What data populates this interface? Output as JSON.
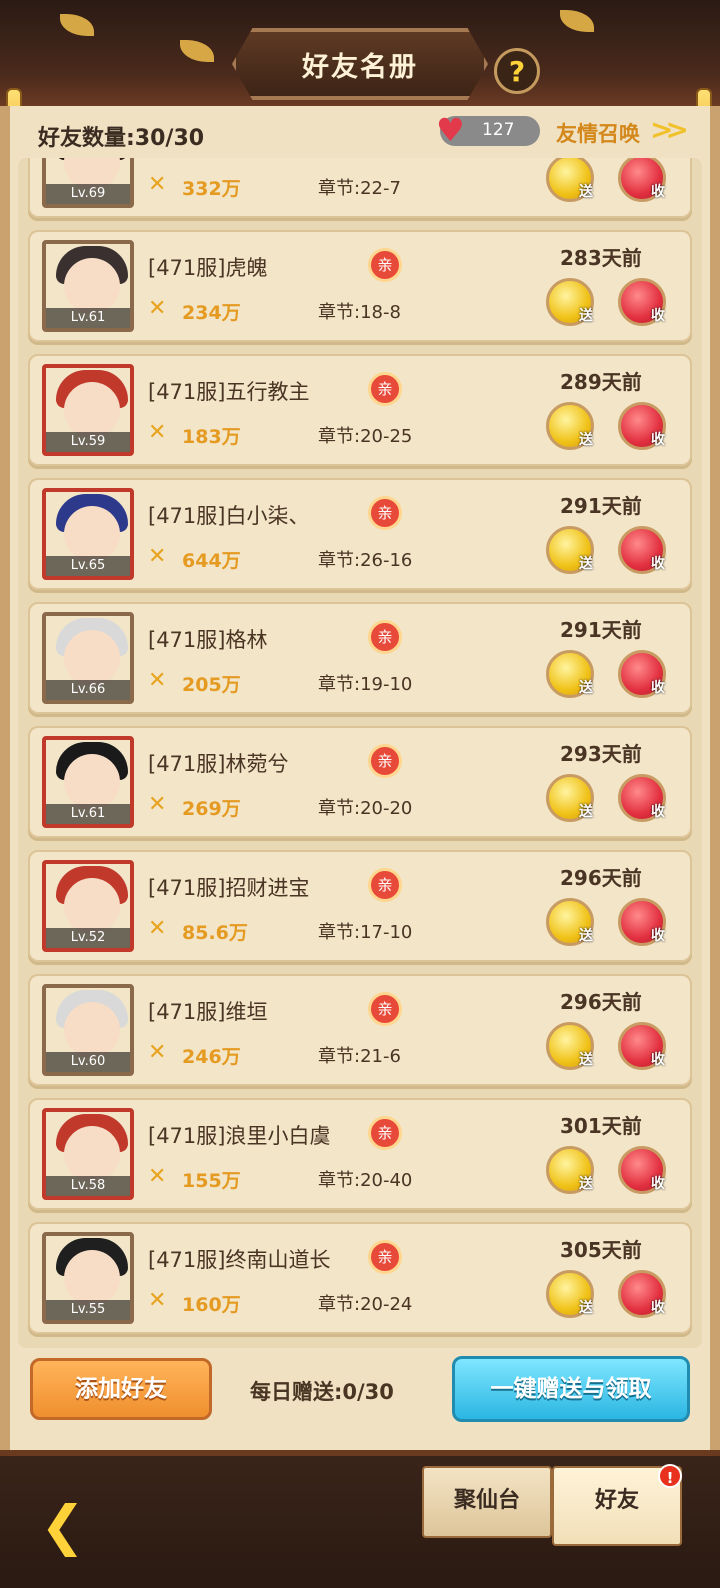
{
  "header": {
    "title": "好友名册",
    "help_glyph": "?"
  },
  "summary": {
    "friend_count_label": "好友数量:30/30",
    "hearts": "127",
    "summon_label": "友情召唤",
    "summon_arrow": ">>"
  },
  "friends": [
    {
      "name": "",
      "kin": "",
      "level": "Lv.69",
      "power": "332万",
      "chapter": "章节:22-7",
      "days": "",
      "send": "送",
      "recv": "收"
    },
    {
      "name": "[471服]虎魄",
      "kin": "亲",
      "level": "Lv.61",
      "power": "234万",
      "chapter": "章节:18-8",
      "days": "283天前",
      "send": "送",
      "recv": "收"
    },
    {
      "name": "[471服]五行教主",
      "kin": "亲",
      "level": "Lv.59",
      "power": "183万",
      "chapter": "章节:20-25",
      "days": "289天前",
      "send": "送",
      "recv": "收"
    },
    {
      "name": "[471服]白小柒、",
      "kin": "亲",
      "level": "Lv.65",
      "power": "644万",
      "chapter": "章节:26-16",
      "days": "291天前",
      "send": "送",
      "recv": "收"
    },
    {
      "name": "[471服]格林",
      "kin": "亲",
      "level": "Lv.66",
      "power": "205万",
      "chapter": "章节:19-10",
      "days": "291天前",
      "send": "送",
      "recv": "收"
    },
    {
      "name": "[471服]林菀兮",
      "kin": "亲",
      "level": "Lv.61",
      "power": "269万",
      "chapter": "章节:20-20",
      "days": "293天前",
      "send": "送",
      "recv": "收"
    },
    {
      "name": "[471服]招财进宝",
      "kin": "亲",
      "level": "Lv.52",
      "power": "85.6万",
      "chapter": "章节:17-10",
      "days": "296天前",
      "send": "送",
      "recv": "收"
    },
    {
      "name": "[471服]维垣",
      "kin": "亲",
      "level": "Lv.60",
      "power": "246万",
      "chapter": "章节:21-6",
      "days": "296天前",
      "send": "送",
      "recv": "收"
    },
    {
      "name": "[471服]浪里小白虞",
      "kin": "亲",
      "level": "Lv.58",
      "power": "155万",
      "chapter": "章节:20-40",
      "days": "301天前",
      "send": "送",
      "recv": "收"
    },
    {
      "name": "[471服]终南山道长",
      "kin": "亲",
      "level": "Lv.55",
      "power": "160万",
      "chapter": "章节:20-24",
      "days": "305天前",
      "send": "送",
      "recv": "收"
    }
  ],
  "actions": {
    "add_friend": "添加好友",
    "daily_gift": "每日赠送:0/30",
    "one_key": "一键赠送与领取"
  },
  "nav": {
    "back_icon": "back-arrow-icon",
    "tab1": "聚仙台",
    "tab2": "好友",
    "badge": "!"
  },
  "colors": {
    "panel_bg": "#efe1c2",
    "send": "#f0c218",
    "recv": "#e23040",
    "accent_orange": "#f08f2e",
    "accent_blue": "#2bb6e2"
  }
}
